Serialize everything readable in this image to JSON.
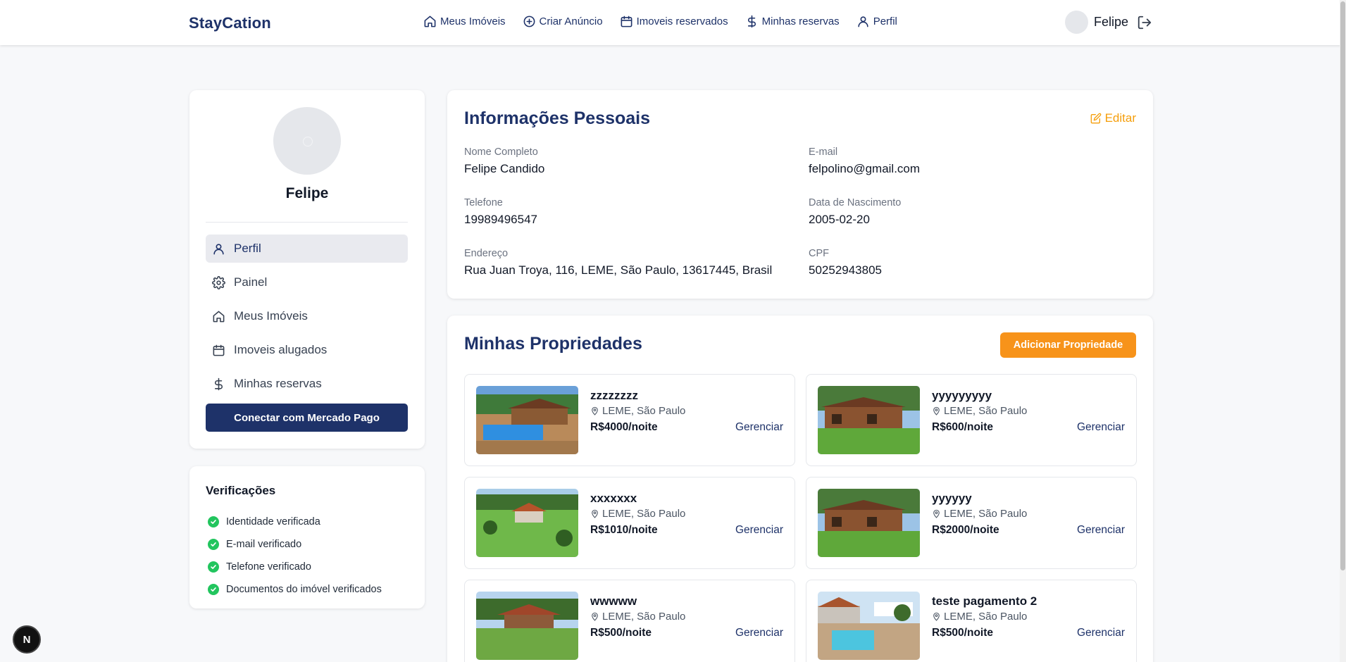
{
  "header": {
    "brand": "StayCation",
    "nav": [
      {
        "label": "Meus Imóveis",
        "icon": "home-icon"
      },
      {
        "label": "Criar Anúncio",
        "icon": "plus-circle-icon"
      },
      {
        "label": "Imoveis reservados",
        "icon": "calendar-icon"
      },
      {
        "label": "Minhas reservas",
        "icon": "dollar-icon"
      },
      {
        "label": "Perfil",
        "icon": "user-icon"
      }
    ],
    "user_name": "Felipe"
  },
  "profile": {
    "name": "Felipe",
    "menu": [
      {
        "label": "Perfil",
        "icon": "user-icon",
        "active": true
      },
      {
        "label": "Painel",
        "icon": "gear-icon"
      },
      {
        "label": "Meus Imóveis",
        "icon": "home-icon"
      },
      {
        "label": "Imoveis alugados",
        "icon": "calendar-icon"
      },
      {
        "label": "Minhas reservas",
        "icon": "dollar-icon"
      }
    ],
    "mp_button": "Conectar com Mercado Pago"
  },
  "verifications": {
    "title": "Verificações",
    "items": [
      "Identidade verificada",
      "E-mail verificado",
      "Telefone verificado",
      "Documentos do imóvel verificados"
    ]
  },
  "personal_info": {
    "title": "Informações Pessoais",
    "edit_label": "Editar",
    "fields": [
      {
        "label": "Nome Completo",
        "value": "Felipe Candido"
      },
      {
        "label": "E-mail",
        "value": "felpolino@gmail.com"
      },
      {
        "label": "Telefone",
        "value": "19989496547"
      },
      {
        "label": "Data de Nascimento",
        "value": "2005-02-20"
      },
      {
        "label": "Endereço",
        "value": "Rua Juan Troya, 116, LEME, São Paulo, 13617445, Brasil"
      },
      {
        "label": "CPF",
        "value": "50252943805"
      }
    ]
  },
  "properties": {
    "title": "Minhas Propriedades",
    "add_label": "Adicionar Propriedade",
    "manage_label": "Gerenciar",
    "items": [
      {
        "title": "zzzzzzzz",
        "location": "LEME, São Paulo",
        "price": "R$4000/noite",
        "image": "pool-house"
      },
      {
        "title": "yyyyyyyyy",
        "location": "LEME, São Paulo",
        "price": "R$600/noite",
        "image": "wood-cabin"
      },
      {
        "title": "xxxxxxx",
        "location": "LEME, São Paulo",
        "price": "R$1010/noite",
        "image": "farm-hill"
      },
      {
        "title": "yyyyyy",
        "location": "LEME, São Paulo",
        "price": "R$2000/noite",
        "image": "wood-cabin"
      },
      {
        "title": "wwwww",
        "location": "LEME, São Paulo",
        "price": "R$500/noite",
        "image": "lawn-house"
      },
      {
        "title": "teste pagamento 2",
        "location": "LEME, São Paulo",
        "price": "R$500/noite",
        "image": "pool-terrace"
      }
    ]
  },
  "badge": "N",
  "colors": {
    "primary": "#1e3269",
    "accent": "#f7931a",
    "success": "#22c55e"
  }
}
